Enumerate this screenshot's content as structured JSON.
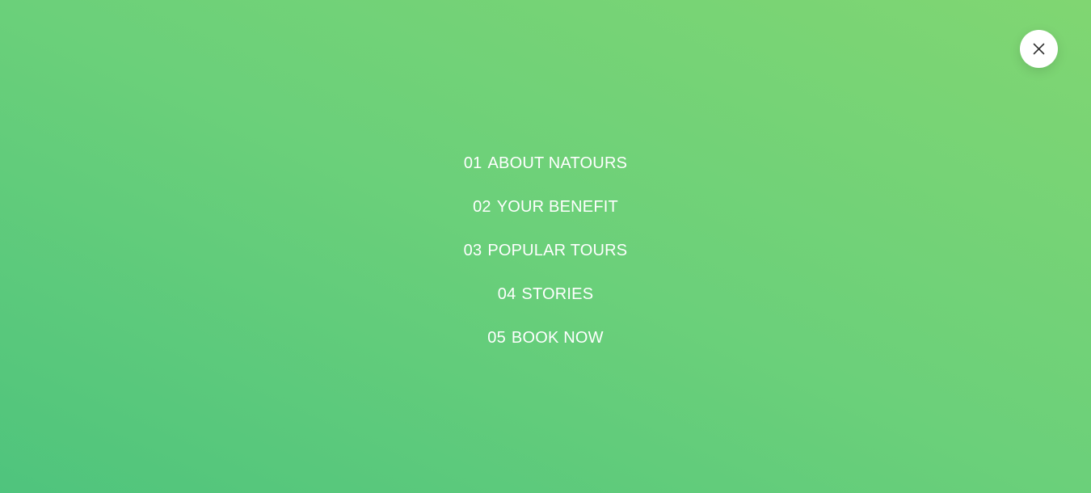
{
  "navigation": {
    "items": [
      {
        "number": "01",
        "label": "ABOUT NATOURS"
      },
      {
        "number": "02",
        "label": "YOUR BENEFIT"
      },
      {
        "number": "03",
        "label": "POPULAR TOURS"
      },
      {
        "number": "04",
        "label": "STORIES"
      },
      {
        "number": "05",
        "label": "BOOK NOW"
      }
    ]
  },
  "close_button": {
    "icon": "close-icon"
  },
  "colors": {
    "gradient_start": "#4fc47d",
    "gradient_end": "#80d672",
    "text": "#ffffff",
    "button_bg": "#ffffff",
    "icon": "#333333"
  }
}
